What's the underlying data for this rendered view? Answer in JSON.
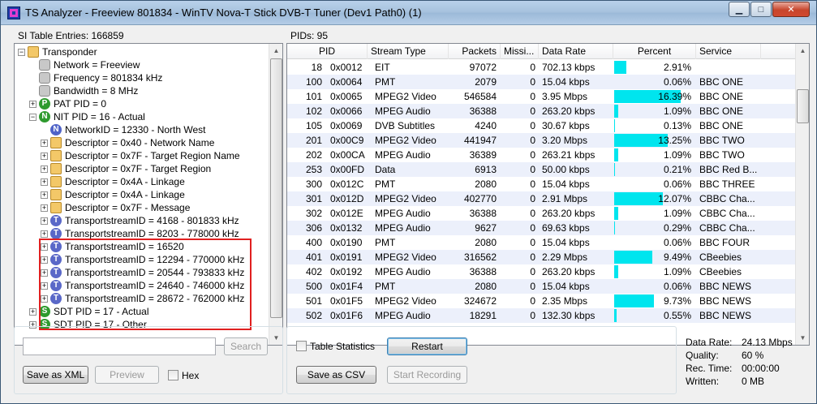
{
  "window": {
    "title": "TS Analyzer - Freeview 801834 - WinTV Nova-T Stick DVB-T Tuner (Dev1 Path0) (1)",
    "min_glyph": "▁",
    "max_glyph": "□",
    "close_glyph": "✕"
  },
  "left_pane": {
    "label": "SI Table Entries: 166859",
    "tree": [
      {
        "text": "Transponder",
        "icon": "folder-icon",
        "level": 0,
        "expander": "−"
      },
      {
        "text": "Network = Freeview",
        "icon": "gray-node-icon",
        "level": 1,
        "expander": ""
      },
      {
        "text": "Frequency = 801834 kHz",
        "icon": "gray-node-icon",
        "level": 1,
        "expander": ""
      },
      {
        "text": "Bandwidth = 8 MHz",
        "icon": "gray-node-icon",
        "level": 1,
        "expander": ""
      },
      {
        "text": "PAT PID = 0",
        "icon": "p-icon",
        "letter": "P",
        "level": 1,
        "expander": "+"
      },
      {
        "text": "NIT PID = 16 - Actual",
        "icon": "n-icon",
        "letter": "N",
        "level": 1,
        "expander": "−"
      },
      {
        "text": "NetworkID = 12330 - North West",
        "icon": "n-blue-icon",
        "letter": "N",
        "level": 2,
        "expander": ""
      },
      {
        "text": "Descriptor = 0x40 - Network Name",
        "icon": "folder-icon",
        "level": 2,
        "expander": "+"
      },
      {
        "text": "Descriptor = 0x7F - Target Region Name",
        "icon": "folder-icon",
        "level": 2,
        "expander": "+"
      },
      {
        "text": "Descriptor = 0x7F - Target Region",
        "icon": "folder-icon",
        "level": 2,
        "expander": "+"
      },
      {
        "text": "Descriptor = 0x4A - Linkage",
        "icon": "folder-icon",
        "level": 2,
        "expander": "+"
      },
      {
        "text": "Descriptor = 0x4A - Linkage",
        "icon": "folder-icon",
        "level": 2,
        "expander": "+"
      },
      {
        "text": "Descriptor = 0x7F - Message",
        "icon": "folder-icon",
        "level": 2,
        "expander": "+"
      },
      {
        "text": "TransportstreamID = 4168 - 801833 kHz",
        "icon": "t-icon",
        "letter": "T",
        "level": 2,
        "expander": "+"
      },
      {
        "text": "TransportstreamID = 8203 - 778000 kHz",
        "icon": "t-icon",
        "letter": "T",
        "level": 2,
        "expander": "+"
      },
      {
        "text": "TransportstreamID = 16520",
        "icon": "t-icon",
        "letter": "T",
        "level": 2,
        "expander": "+"
      },
      {
        "text": "TransportstreamID = 12294 - 770000 kHz",
        "icon": "t-icon",
        "letter": "T",
        "level": 2,
        "expander": "+"
      },
      {
        "text": "TransportstreamID = 20544 - 793833 kHz",
        "icon": "t-icon",
        "letter": "T",
        "level": 2,
        "expander": "+"
      },
      {
        "text": "TransportstreamID = 24640 - 746000 kHz",
        "icon": "t-icon",
        "letter": "T",
        "level": 2,
        "expander": "+"
      },
      {
        "text": "TransportstreamID = 28672 - 762000 kHz",
        "icon": "t-icon",
        "letter": "T",
        "level": 2,
        "expander": "+"
      },
      {
        "text": "SDT PID = 17 - Actual",
        "icon": "s-icon",
        "letter": "S",
        "level": 1,
        "expander": "+"
      },
      {
        "text": "SDT PID = 17 - Other",
        "icon": "s-icon",
        "letter": "S",
        "level": 1,
        "expander": "+"
      }
    ],
    "search_value": "",
    "search_label": "Search",
    "save_xml_label": "Save as XML",
    "preview_label": "Preview",
    "hex_label": "Hex"
  },
  "right_pane": {
    "label": "PIDs: 95",
    "columns": [
      "PID",
      "Stream Type",
      "Packets",
      "Missi...",
      "Data Rate",
      "Percent",
      "Service"
    ],
    "rows": [
      {
        "pid": "18",
        "hex": "0x0012",
        "type": "EIT",
        "packets": "97072",
        "missing": "0",
        "rate": "702.13 kbps",
        "percent": "2.91%",
        "pct": 2.91,
        "service": ""
      },
      {
        "pid": "100",
        "hex": "0x0064",
        "type": "PMT",
        "packets": "2079",
        "missing": "0",
        "rate": "15.04 kbps",
        "percent": "0.06%",
        "pct": 0.06,
        "service": "BBC ONE"
      },
      {
        "pid": "101",
        "hex": "0x0065",
        "type": "MPEG2 Video",
        "packets": "546584",
        "missing": "0",
        "rate": "3.95 Mbps",
        "percent": "16.39%",
        "pct": 16.39,
        "service": "BBC ONE"
      },
      {
        "pid": "102",
        "hex": "0x0066",
        "type": "MPEG Audio",
        "packets": "36388",
        "missing": "0",
        "rate": "263.20 kbps",
        "percent": "1.09%",
        "pct": 1.09,
        "service": "BBC ONE"
      },
      {
        "pid": "105",
        "hex": "0x0069",
        "type": "DVB Subtitles",
        "packets": "4240",
        "missing": "0",
        "rate": "30.67 kbps",
        "percent": "0.13%",
        "pct": 0.13,
        "service": "BBC ONE"
      },
      {
        "pid": "201",
        "hex": "0x00C9",
        "type": "MPEG2 Video",
        "packets": "441947",
        "missing": "0",
        "rate": "3.20 Mbps",
        "percent": "13.25%",
        "pct": 13.25,
        "service": "BBC TWO"
      },
      {
        "pid": "202",
        "hex": "0x00CA",
        "type": "MPEG Audio",
        "packets": "36389",
        "missing": "0",
        "rate": "263.21 kbps",
        "percent": "1.09%",
        "pct": 1.09,
        "service": "BBC TWO"
      },
      {
        "pid": "253",
        "hex": "0x00FD",
        "type": "Data",
        "packets": "6913",
        "missing": "0",
        "rate": "50.00 kbps",
        "percent": "0.21%",
        "pct": 0.21,
        "service": "BBC Red B..."
      },
      {
        "pid": "300",
        "hex": "0x012C",
        "type": "PMT",
        "packets": "2080",
        "missing": "0",
        "rate": "15.04 kbps",
        "percent": "0.06%",
        "pct": 0.06,
        "service": "BBC THREE"
      },
      {
        "pid": "301",
        "hex": "0x012D",
        "type": "MPEG2 Video",
        "packets": "402770",
        "missing": "0",
        "rate": "2.91 Mbps",
        "percent": "12.07%",
        "pct": 12.07,
        "service": "CBBC Cha..."
      },
      {
        "pid": "302",
        "hex": "0x012E",
        "type": "MPEG Audio",
        "packets": "36388",
        "missing": "0",
        "rate": "263.20 kbps",
        "percent": "1.09%",
        "pct": 1.09,
        "service": "CBBC Cha..."
      },
      {
        "pid": "306",
        "hex": "0x0132",
        "type": "MPEG Audio",
        "packets": "9627",
        "missing": "0",
        "rate": "69.63 kbps",
        "percent": "0.29%",
        "pct": 0.29,
        "service": "CBBC Cha..."
      },
      {
        "pid": "400",
        "hex": "0x0190",
        "type": "PMT",
        "packets": "2080",
        "missing": "0",
        "rate": "15.04 kbps",
        "percent": "0.06%",
        "pct": 0.06,
        "service": "BBC FOUR"
      },
      {
        "pid": "401",
        "hex": "0x0191",
        "type": "MPEG2 Video",
        "packets": "316562",
        "missing": "0",
        "rate": "2.29 Mbps",
        "percent": "9.49%",
        "pct": 9.49,
        "service": "CBeebies"
      },
      {
        "pid": "402",
        "hex": "0x0192",
        "type": "MPEG Audio",
        "packets": "36388",
        "missing": "0",
        "rate": "263.20 kbps",
        "percent": "1.09%",
        "pct": 1.09,
        "service": "CBeebies"
      },
      {
        "pid": "500",
        "hex": "0x01F4",
        "type": "PMT",
        "packets": "2080",
        "missing": "0",
        "rate": "15.04 kbps",
        "percent": "0.06%",
        "pct": 0.06,
        "service": "BBC NEWS"
      },
      {
        "pid": "501",
        "hex": "0x01F5",
        "type": "MPEG2 Video",
        "packets": "324672",
        "missing": "0",
        "rate": "2.35 Mbps",
        "percent": "9.73%",
        "pct": 9.73,
        "service": "BBC NEWS"
      },
      {
        "pid": "502",
        "hex": "0x01F6",
        "type": "MPEG Audio",
        "packets": "18291",
        "missing": "0",
        "rate": "132.30 kbps",
        "percent": "0.55%",
        "pct": 0.55,
        "service": "BBC NEWS"
      }
    ],
    "table_stats_label": "Table Statistics",
    "restart_label": "Restart",
    "save_csv_label": "Save as CSV",
    "start_recording_label": "Start Recording",
    "stats": [
      {
        "label": "Data Rate:",
        "value": "24.13 Mbps"
      },
      {
        "label": "Quality:",
        "value": "60 %"
      },
      {
        "label": "Rec. Time:",
        "value": "00:00:00"
      },
      {
        "label": "Written:",
        "value": "0 MB"
      }
    ]
  },
  "colors": {
    "percent_bar": "#00e5ee",
    "highlight_box": "#e02020",
    "row_alt": "#ecf0fb"
  }
}
